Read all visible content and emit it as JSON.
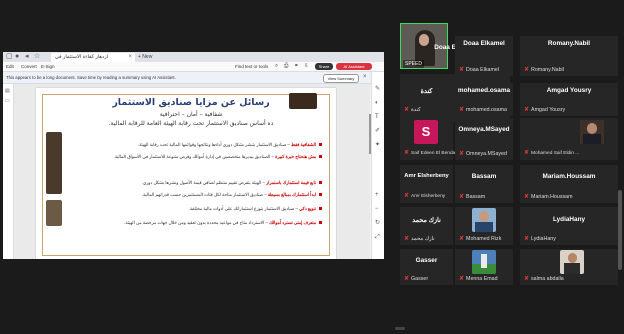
{
  "browser": {
    "tab_title": "ازدهار كفاءة الاستثمار في",
    "new_tab_label": "+ New",
    "toolbar_items": [
      "Edit",
      "Convert",
      "E-Sign"
    ],
    "find_label": "Find text or tools",
    "share_label": "Share",
    "assistant_label": "AI Assistant"
  },
  "ai_bar": {
    "text": "This appears to be a long document. Save time by reading a summary using AI Assistant.",
    "view_summary": "View Summary"
  },
  "document": {
    "title": "رسائل عن مزايا صناديق الاستثمار",
    "subtitle": "شفافية – أمان – احترافية",
    "tagline": "ده أساس صناديق الاستثمار تحت رقابة الهيئة العامة للرقابة المالية.",
    "lines": [
      {
        "key": "الشفافية فقط",
        "rest": "صناديق الاستثمار بتنشر بشكل دوري أداءها ونتائجها وقوائمها المالية تحت رقابة الهيئة."
      },
      {
        "key": "مش هتحتاج خبرة كبيرة",
        "rest": "الصناديق بيديرها متخصصين في إدارة أموالك وفرص متنوعة للاستثمار في الأسواق المالية."
      },
      {
        "key": "تابع قيمة استثمارك باستمرار",
        "rest": "الهيئة بتفرض تقييم منتظم لصافي قيمة الأصول ونشرها بشكل دوري."
      },
      {
        "key": "ابدأ استثمارك بمبالغ بسيطة",
        "rest": "صناديق الاستثمار متاحة لكل فئات المستثمرين حسب قدراتهم المالية."
      },
      {
        "key": "تنويع ذكي",
        "rest": "صناديق الاستثمار بتوزع استثماراتك على أدوات مالية مختلفة."
      },
      {
        "key": "متعرف إمتى تسترد أموالك",
        "rest": "الاسترداد متاح في مواعيد محددة بدون تعقيد ومن خلال جهات مرخصة من الهيئة."
      }
    ]
  },
  "participants": {
    "self": {
      "name": "SPEED"
    },
    "tiles": [
      {
        "name": "Doaa Elkamel",
        "label": "Doaa Elkamel"
      },
      {
        "name": "Romany.Nabil",
        "label": "Romany.Nabil"
      },
      {
        "name": "كندة",
        "label": "كندة"
      },
      {
        "name": "mohamed.osama",
        "label": "mohamed.osama"
      },
      {
        "name": "Amgad Yousry",
        "label": "Amgad Yousry"
      },
      {
        "name": "",
        "label": "Saif Edeen El Bendari",
        "avatar_letter": "S"
      },
      {
        "name": "Omneya.MSayed",
        "label": "Omneya.MSayed"
      },
      {
        "name": "",
        "label": "Mohamed Saif Eldin ..."
      },
      {
        "name": "Amr Elsherbeny",
        "label": "Amr Elsherbeny"
      },
      {
        "name": "Bassam",
        "label": "Bassam"
      },
      {
        "name": "Mariam.Houssam",
        "label": "Mariam.Houssam"
      },
      {
        "name": "نازك محمد",
        "label": "نازك محمد"
      },
      {
        "name": "",
        "label": "Mohamed Rizk"
      },
      {
        "name": "LydiaHany",
        "label": "LydiaHany"
      },
      {
        "name": "Gasser",
        "label": "Gasser"
      },
      {
        "name": "",
        "label": "Menna Emad"
      },
      {
        "name": "",
        "label": "salma abdalla"
      }
    ]
  },
  "colors": {
    "accent_red": "#d9333f",
    "doc_title": "#2a3e7a",
    "avatar_s": "#c8165b",
    "active_border": "#3ddc5a"
  }
}
